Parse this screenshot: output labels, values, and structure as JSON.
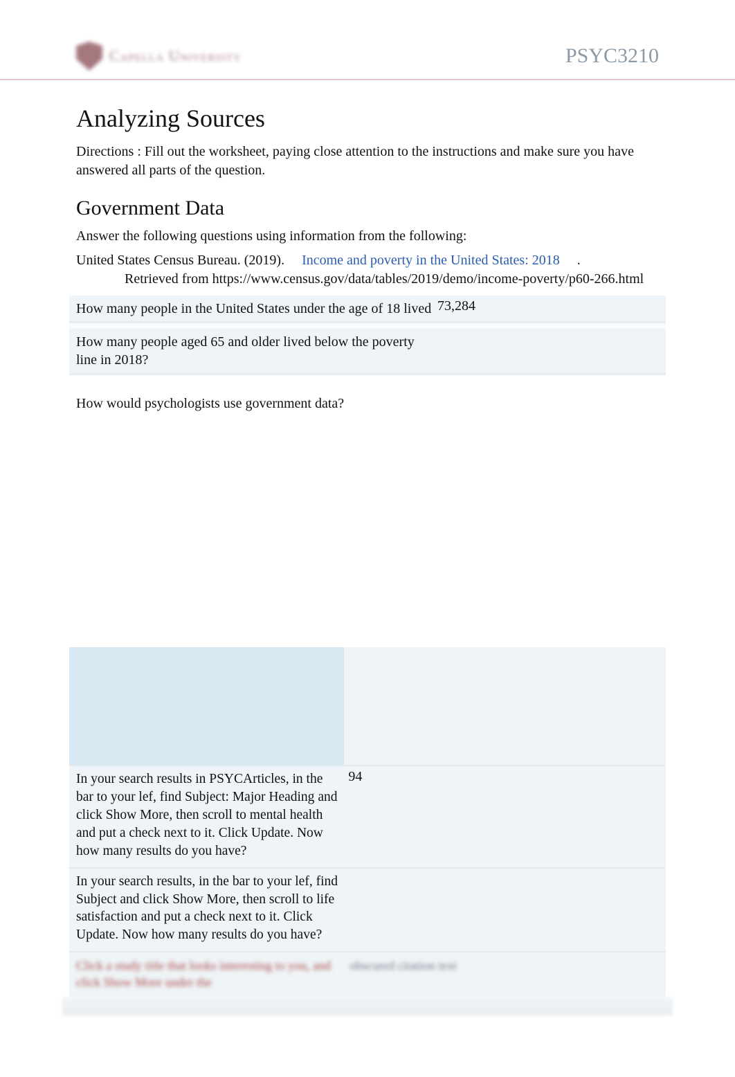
{
  "header": {
    "logo_text": "Capella University",
    "course_code": "PSYC3210"
  },
  "title": "Analyzing Sources",
  "directions": {
    "label": "Directions",
    "text": ": Fill out the worksheet, paying close attention to the instructions and make sure you have answered all parts of the question."
  },
  "section_heading": "Government Data",
  "section_intro": "Answer the following questions using information from the following:",
  "citation": {
    "author_year": "United States Census Bureau. (2019).",
    "title_link": "Income and poverty in the United States: 2018",
    "period": ".",
    "retrieved": "Retrieved from https://www.census.gov/data/tables/2019/demo/income-poverty/p60-266.html"
  },
  "qa": [
    {
      "question": "How many people in the United States under the age of 18 lived",
      "answer": "73,284"
    },
    {
      "question": "How many people aged 65 and older lived below the poverty line in 2018?",
      "answer": ""
    }
  ],
  "open_question": "How would psychologists use government data?",
  "lower": {
    "blue_right_hint": "",
    "rows": [
      {
        "question_parts": {
          "prefix": "In your search results in PSYCArticles, in the",
          "bar": " bar to your lef,",
          "find": " find ",
          "subj": "Subject: Major Heading",
          "and_click": " and click ",
          "showmore": "Show More",
          "then_scroll": ", then scroll to ",
          "term": "mental health",
          "rest": " and put a check next to it. Click ",
          "update": "Update",
          "tail": ". Now how many results do you have?"
        },
        "answer": "94"
      },
      {
        "question_parts": {
          "prefix": "In your search results, in the ",
          "bar": "bar to your lef,",
          "find": " find ",
          "subj": "Subject",
          "and_click": " and click ",
          "showmore": "Show More",
          "then_scroll": ", then scroll to ",
          "term": "life satisfaction",
          "rest": " and put a check next to it. Click ",
          "update": "Update",
          "tail": ". Now how many results do you have?"
        },
        "answer": ""
      }
    ],
    "obscured": {
      "left": "Click a study title that looks interesting to you, and click Show More under the",
      "right": "obscured citation text"
    }
  }
}
